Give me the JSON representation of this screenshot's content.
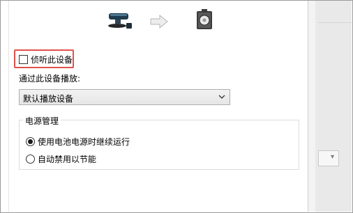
{
  "listen": {
    "checkbox_label": "侦听此设备",
    "checked": false
  },
  "playback": {
    "label": "通过此设备播放:",
    "selected_device": "默认播放设备"
  },
  "power_management": {
    "title": "电源管理",
    "options": [
      {
        "label": "使用电池电源时继续运行",
        "selected": true
      },
      {
        "label": "自动禁用以节能",
        "selected": false
      }
    ]
  },
  "icons": {
    "source": "microphone-device-icon",
    "flow": "right-arrow-icon",
    "target": "speaker-device-icon",
    "dropdown": "chevron-down-icon"
  },
  "colors": {
    "highlight": "#e0524b",
    "window_bg": "#ffffff",
    "backdrop": "#f3f3f3"
  }
}
